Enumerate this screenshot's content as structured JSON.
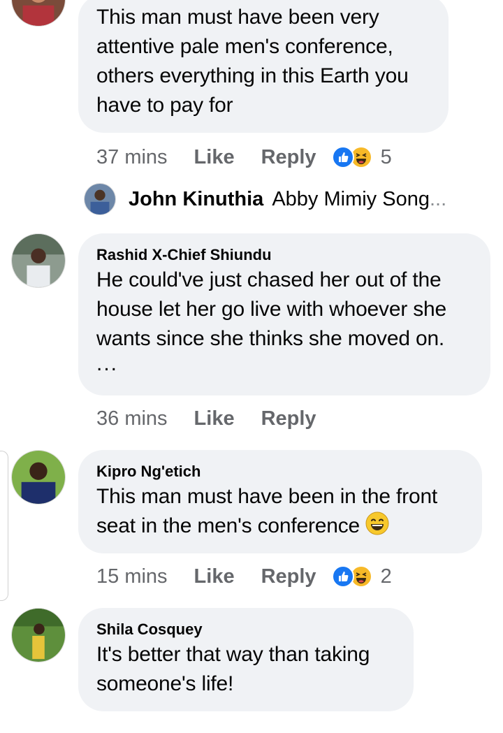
{
  "comments": [
    {
      "author": "",
      "lines": [
        "This man must have been very",
        "attentive pale men's conference,",
        "others everything in this Earth you",
        "have to pay for"
      ],
      "time": "37 mins",
      "like_label": "Like",
      "reply_label": "Reply",
      "reaction_count": "5"
    },
    {
      "author": "Rashid X-Chief Shiundu",
      "lines": [
        "He could've just chased her out of the",
        "house let her go live with whoever she",
        "wants since she thinks she moved on."
      ],
      "ellipsis": "...",
      "time": "36 mins",
      "like_label": "Like",
      "reply_label": "Reply"
    },
    {
      "author": "Kipro Ng'etich",
      "lines": [
        "This man must have been in the front",
        "seat in the men's conference"
      ],
      "time": "15 mins",
      "like_label": "Like",
      "reply_label": "Reply",
      "reaction_count": "2"
    },
    {
      "author": "Shila Cosquey",
      "lines": [
        "It's better that way than taking",
        "someone's life!"
      ]
    }
  ],
  "reply_preview": {
    "name": "John Kinuthia",
    "text": "Abby Mimiy Song",
    "ellipsis": "..."
  },
  "icons": {
    "like": "like-reaction-icon",
    "haha": "haha-reaction-icon",
    "grin": "grinning-emoji-icon"
  },
  "colors": {
    "bubble": "#f0f2f5",
    "meta": "#65676b",
    "like_blue": "#1877f2",
    "haha_yellow": "#f7b928"
  }
}
